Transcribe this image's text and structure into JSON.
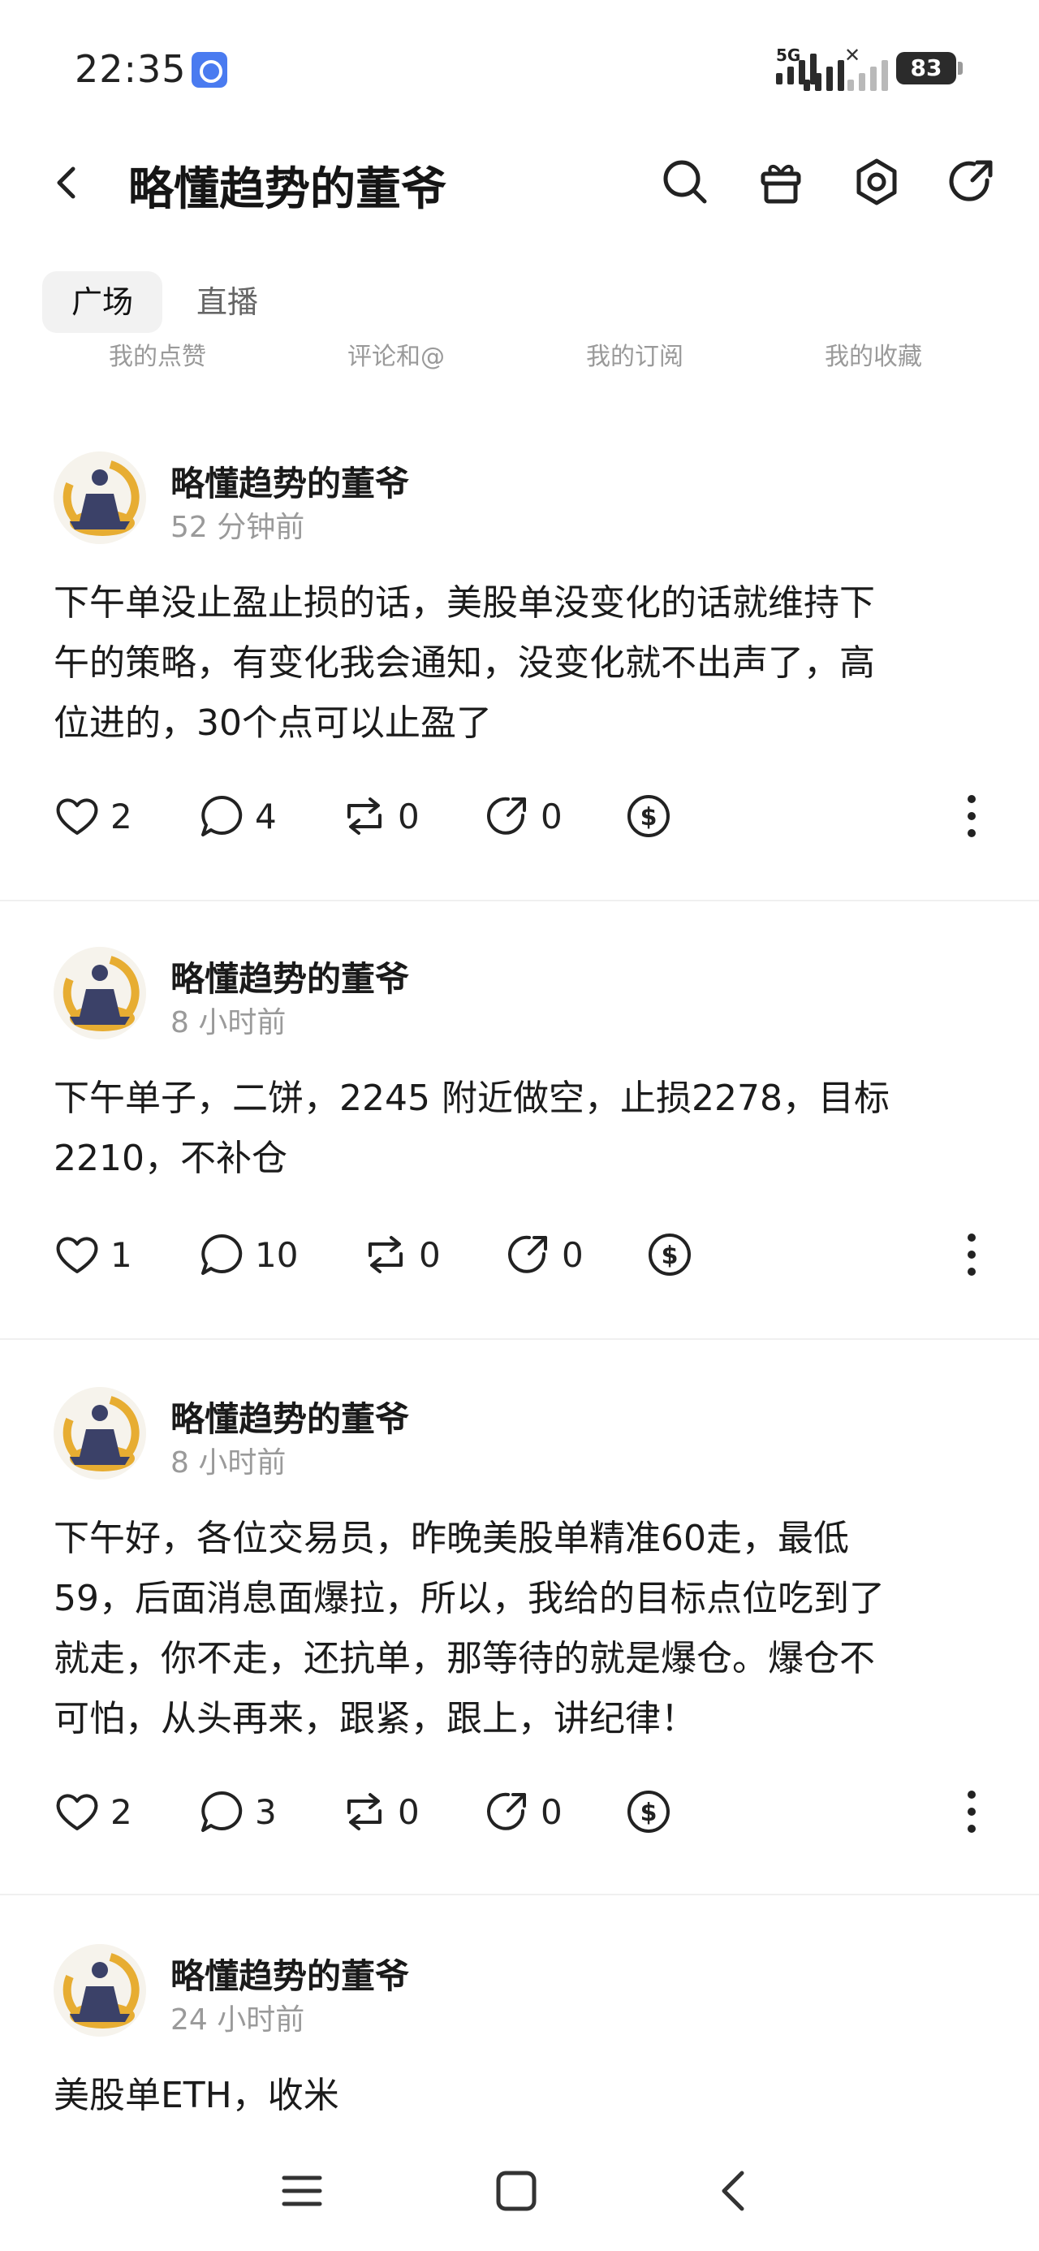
{
  "status_bar": {
    "time": "22:35",
    "network_label": "5G",
    "battery": "83",
    "icons": [
      "app-notification-icon",
      "signal-icon",
      "no-signal-icon",
      "battery-icon"
    ]
  },
  "header": {
    "title": "略懂趋势的董爷",
    "icons": [
      "back-icon",
      "search-icon",
      "gift-icon",
      "settings-icon",
      "share-icon"
    ]
  },
  "tabs": [
    {
      "label": "广场",
      "active": true
    },
    {
      "label": "直播",
      "active": false
    }
  ],
  "subnav": [
    "我的点赞",
    "评论和@",
    "我的订阅",
    "我的收藏"
  ],
  "posts": [
    {
      "author": "略懂趋势的董爷",
      "time": "52 分钟前",
      "lines": [
        "下午单没止盈止损的话，美股单没变化的话就维持下",
        "午的策略，有变化我会通知，没变化就不出声了，高",
        "位进的，30个点可以止盈了"
      ],
      "likes": "2",
      "comments": "4",
      "reposts": "0",
      "shares": "0"
    },
    {
      "author": "略懂趋势的董爷",
      "time": "8 小时前",
      "lines": [
        "下午单子，二饼，2245 附近做空，止损2278，目标",
        "2210，不补仓"
      ],
      "likes": "1",
      "comments": "10",
      "reposts": "0",
      "shares": "0"
    },
    {
      "author": "略懂趋势的董爷",
      "time": "8 小时前",
      "lines": [
        "下午好，各位交易员，昨晚美股单精准60走，最低",
        "59，后面消息面爆拉，所以，我给的目标点位吃到了",
        "就走，你不走，还抗单，那等待的就是爆仓。爆仓不",
        "可怕，从头再来，跟紧，跟上，讲纪律！"
      ],
      "likes": "2",
      "comments": "3",
      "reposts": "0",
      "shares": "0"
    },
    {
      "author": "略懂趋势的董爷",
      "time": "24 小时前",
      "lines": [
        "美股单ETH，收米"
      ]
    }
  ],
  "colors": {
    "accent": "#4a7bf0",
    "avatar_gold": "#e7ad32",
    "avatar_navy": "#3b4168",
    "muted": "#9a9a9a"
  }
}
